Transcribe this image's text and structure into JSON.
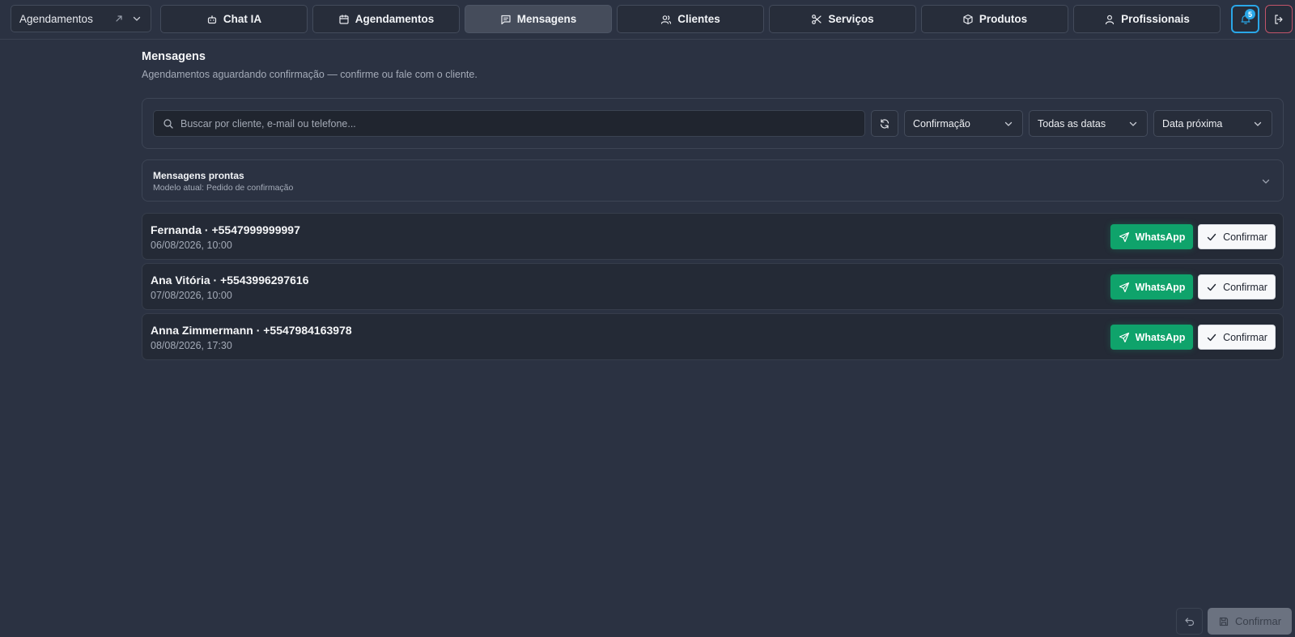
{
  "topbar": {
    "context_select": {
      "label": "Agendamentos"
    },
    "nav": [
      {
        "label": "Chat IA",
        "icon": "bot-icon"
      },
      {
        "label": "Agendamentos",
        "icon": "calendar-icon"
      },
      {
        "label": "Mensagens",
        "icon": "message-square-icon",
        "active": true
      },
      {
        "label": "Clientes",
        "icon": "users-icon"
      },
      {
        "label": "Serviços",
        "icon": "scissors-icon"
      },
      {
        "label": "Produtos",
        "icon": "box-icon"
      },
      {
        "label": "Profissionais",
        "icon": "user-icon"
      }
    ],
    "notifications_count": "5"
  },
  "page": {
    "title": "Mensagens",
    "subtitle": "Agendamentos aguardando confirmação — confirme ou fale com o cliente."
  },
  "filters": {
    "search_placeholder": "Buscar por cliente, e-mail ou telefone...",
    "status": "Confirmação",
    "date_range": "Todas as datas",
    "sort": "Data próxima"
  },
  "templates": {
    "title": "Mensagens prontas",
    "subtitle": "Modelo atual: Pedido de confirmação"
  },
  "appointments": [
    {
      "name": "Fernanda · +5547999999997",
      "datetime": "06/08/2026, 10:00"
    },
    {
      "name": "Ana Vitória · +5543996297616",
      "datetime": "07/08/2026, 10:00"
    },
    {
      "name": "Anna Zimmermann · +5547984163978",
      "datetime": "08/08/2026, 17:30"
    }
  ],
  "actions": {
    "whatsapp_label": "WhatsApp",
    "confirm_label": "Confirmar",
    "save_label": "Confirmar"
  },
  "colors": {
    "background": "#2b3242",
    "whatsapp_green": "#0fa36b",
    "accent_blue": "#2aa7e8",
    "logout_red": "#c2546a"
  }
}
